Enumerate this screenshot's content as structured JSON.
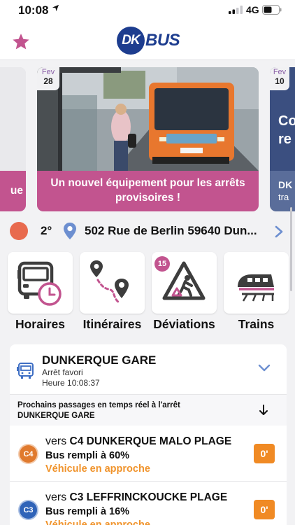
{
  "status_bar": {
    "time": "10:08",
    "network": "4G"
  },
  "header": {
    "logo_dk": "DK",
    "logo_bus": "BUS"
  },
  "colors": {
    "brand_blue": "#1d3d8f",
    "accent_pink": "#c2548f",
    "orange": "#f08a24",
    "line_c4": "#e07a2e",
    "line_c3": "#2f63b8"
  },
  "carousel": {
    "left_card": {
      "caption": "ue"
    },
    "main_card": {
      "month": "Fev",
      "day": "28",
      "caption": "Un nouvel équipement pour les arrêts provisoires !"
    },
    "right_card": {
      "month": "Fev",
      "day": "10",
      "caption_top": "Co",
      "caption_mid": "re",
      "caption_bottom": "DK",
      "caption_last": "tra"
    }
  },
  "location": {
    "temperature": "2°",
    "address": "502 Rue de Berlin 59640 Dun..."
  },
  "quick_actions": [
    {
      "label": "Horaires",
      "icon": "bus-clock-icon"
    },
    {
      "label": "Itinéraires",
      "icon": "route-icon"
    },
    {
      "label": "Déviations",
      "icon": "roadwork-icon",
      "badge": "15"
    },
    {
      "label": "Trains",
      "icon": "train-icon"
    }
  ],
  "stop": {
    "name": "DUNKERQUE GARE",
    "favorite_label": "Arrêt favori",
    "hour_label": "Heure 10:08:37"
  },
  "realtime": {
    "line1": "Prochains passages en temps réel à l'arrêt",
    "line2": "DUNKERQUE GARE"
  },
  "departures": [
    {
      "line": "C4",
      "vers": "vers",
      "destination": "C4 DUNKERQUE MALO PLAGE",
      "fill": "Bus rempli à 60%",
      "status": "Véhicule en approche",
      "time": "0'"
    },
    {
      "line": "C3",
      "vers": "vers",
      "destination": "C3 LEFFRINCKOUCKE PLAGE",
      "fill": "Bus rempli à 16%",
      "status": "Véhicule en approche",
      "time": "0'"
    }
  ]
}
